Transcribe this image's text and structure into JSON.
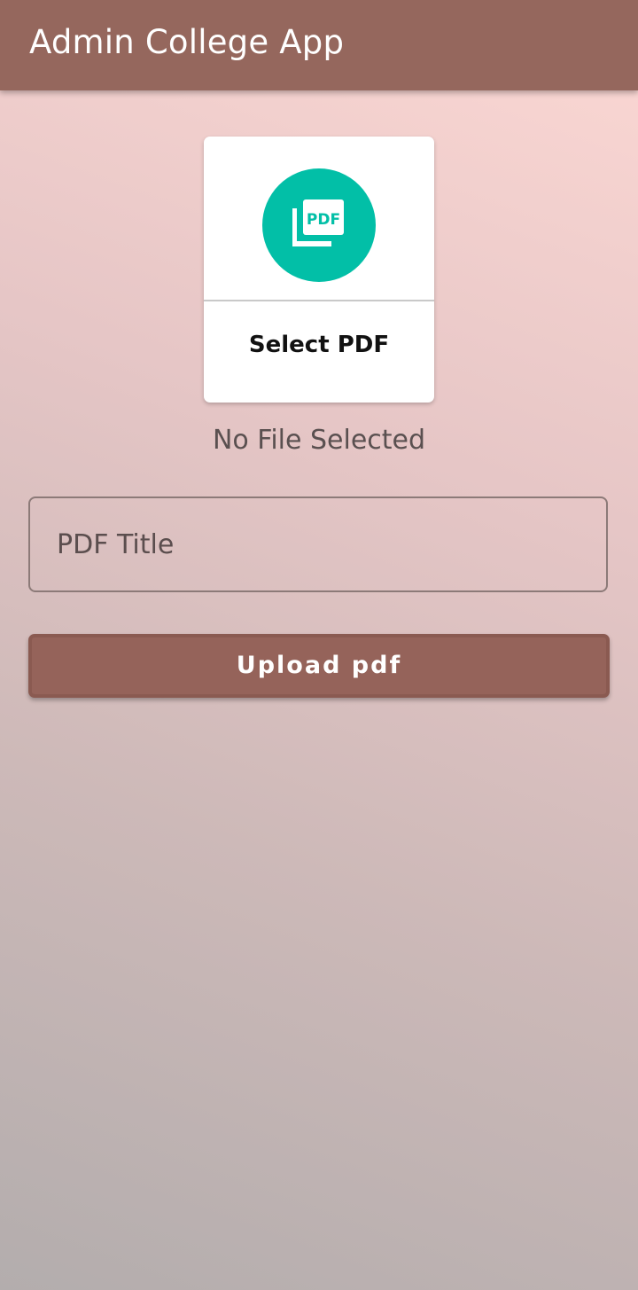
{
  "app_bar": {
    "title": "Admin College App",
    "color": "#95675d"
  },
  "select_card": {
    "icon": "pdf-file-icon",
    "icon_text": "PDF",
    "icon_color": "#02bfa7",
    "label": "Select PDF"
  },
  "file_status": "No File Selected",
  "pdf_title_input": {
    "value": "",
    "placeholder": "PDF Title"
  },
  "upload_button": {
    "label": "Upload pdf",
    "color": "#95635a"
  }
}
